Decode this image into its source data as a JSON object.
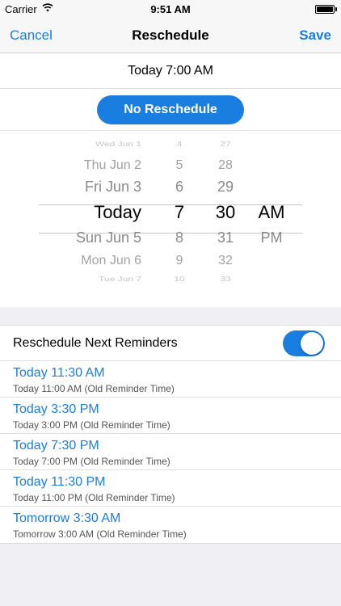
{
  "status_bar": {
    "carrier": "Carrier",
    "time": "9:51 AM"
  },
  "nav": {
    "cancel_label": "Cancel",
    "title": "Reschedule",
    "save_label": "Save"
  },
  "selected_datetime": "Today 7:00 AM",
  "no_reschedule_label": "No Reschedule",
  "picker": {
    "days": [
      "Wed Jun 1",
      "Thu Jun 2",
      "Fri Jun 3",
      "Today",
      "Sun Jun 5",
      "Mon Jun 6",
      "Tue Jun 7"
    ],
    "hours": [
      "4",
      "5",
      "6",
      "7",
      "8",
      "9",
      "10"
    ],
    "minutes": [
      "27",
      "28",
      "29",
      "30",
      "31",
      "32",
      "33"
    ],
    "ampm": [
      "AM",
      "PM"
    ]
  },
  "reschedule_next": {
    "label": "Reschedule Next Reminders",
    "enabled": true
  },
  "reminders": [
    {
      "new": "Today 11:30 AM",
      "old": "Today 11:00 AM (Old Reminder Time)"
    },
    {
      "new": "Today 3:30 PM",
      "old": "Today 3:00 PM (Old Reminder Time)"
    },
    {
      "new": "Today 7:30 PM",
      "old": "Today 7:00 PM (Old Reminder Time)"
    },
    {
      "new": "Today 11:30 PM",
      "old": "Today 11:00 PM (Old Reminder Time)"
    },
    {
      "new": "Tomorrow 3:30 AM",
      "old": "Tomorrow 3:00 AM (Old Reminder Time)"
    }
  ],
  "colors": {
    "accent": "#1a7ee0",
    "background": "#efeff4"
  }
}
